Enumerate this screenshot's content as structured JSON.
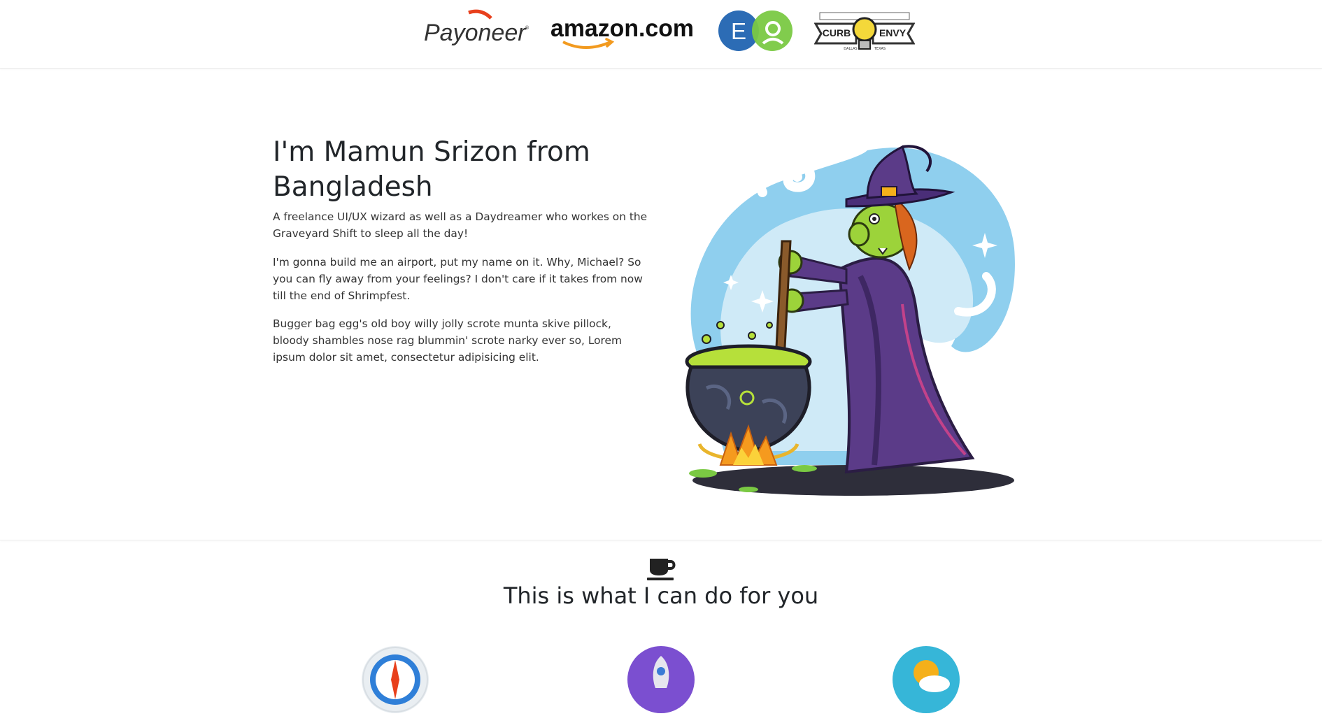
{
  "logos": {
    "payoneer": "Payoneer",
    "amazon": "amazon.com",
    "eo_left": "E",
    "curb_left": "CURB",
    "curb_right": "ENVY",
    "curb_small_left": "DALLAS",
    "curb_small_right": "TEXAS"
  },
  "hero": {
    "title": "I'm Mamun Srizon from Bangladesh",
    "paragraphs": [
      "A freelance UI/UX wizard as well as a Daydreamer who workes on the Graveyard Shift to sleep all the day!",
      "I'm gonna build me an airport, put my name on it. Why, Michael? So you can fly away from your feelings? I don't care if it takes from now till the end of Shrimpfest.",
      "Bugger bag egg's old boy willy jolly scrote munta skive pillock, bloody shambles nose rag blummin' scrote narky ever so, Lorem ipsum dolor sit amet, consectetur adipisicing elit."
    ]
  },
  "services": {
    "title": "This is what I can do for you",
    "icon": "coffee-cup-icon"
  },
  "colors": {
    "payoneer_orange": "#e8401c",
    "amazon_arrow": "#f29a1f",
    "eo_blue": "#2c6cb5",
    "eo_green": "#7ac943",
    "witch_purple": "#5b3b88",
    "cauldron_green": "#b6e03a",
    "swirl_blue": "#8fcfee"
  }
}
